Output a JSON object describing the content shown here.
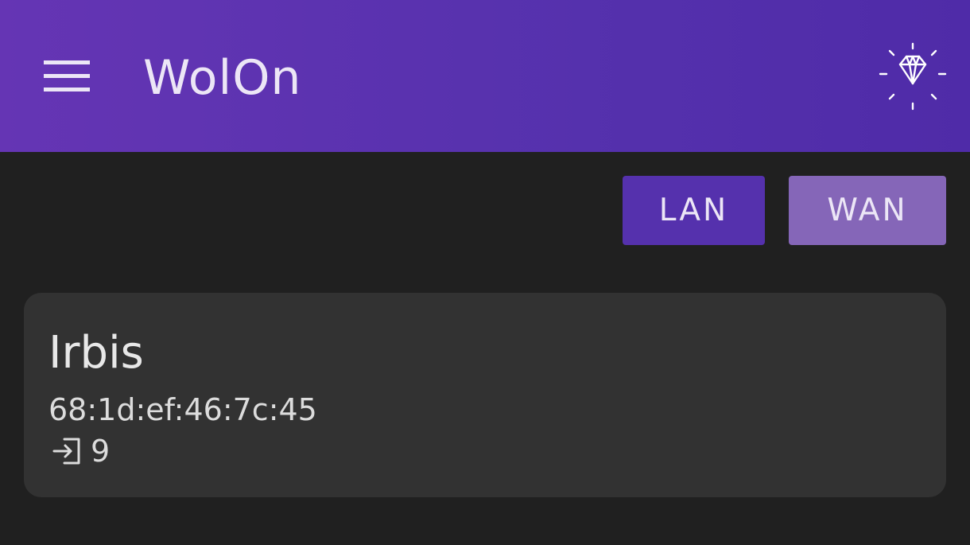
{
  "appbar": {
    "title": "WolOn",
    "menu_icon": "hamburger-menu-icon",
    "premium_icon": "diamond-icon",
    "background": "#5a32b0"
  },
  "mode_toggle": {
    "options": [
      {
        "label": "LAN",
        "selected": true,
        "color": "#5531ad"
      },
      {
        "label": "WAN",
        "selected": false,
        "color": "#8566b8"
      }
    ]
  },
  "devices": [
    {
      "name": "Irbis",
      "mac": "68:1d:ef:46:7c:45",
      "port_icon": "login-icon",
      "port": "9"
    }
  ]
}
